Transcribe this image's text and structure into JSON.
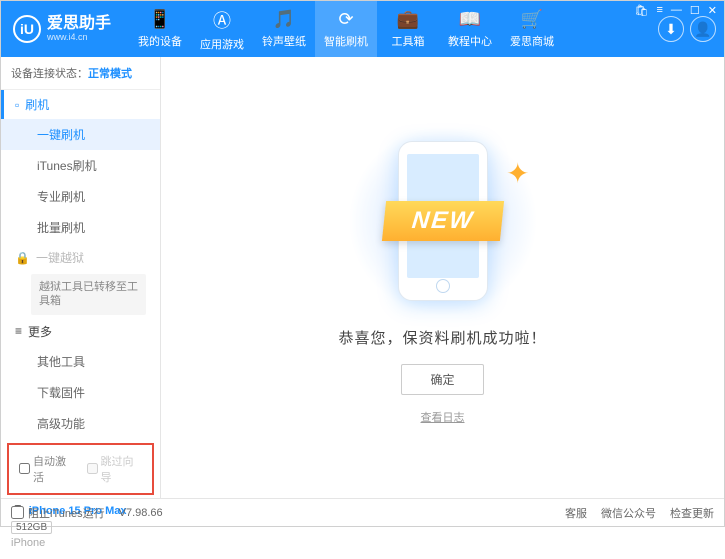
{
  "header": {
    "logo_letter": "iU",
    "app_name": "爱思助手",
    "website": "www.i4.cn",
    "nav": [
      {
        "icon": "📱",
        "label": "我的设备"
      },
      {
        "icon": "Ⓐ",
        "label": "应用游戏"
      },
      {
        "icon": "🎵",
        "label": "铃声壁纸"
      },
      {
        "icon": "⟳",
        "label": "智能刷机"
      },
      {
        "icon": "💼",
        "label": "工具箱"
      },
      {
        "icon": "📖",
        "label": "教程中心"
      },
      {
        "icon": "🛒",
        "label": "爱思商城"
      }
    ]
  },
  "sidebar": {
    "status_label": "设备连接状态：",
    "status_mode": "正常模式",
    "flash_header": "刷机",
    "flash_items": [
      "一键刷机",
      "iTunes刷机",
      "专业刷机",
      "批量刷机"
    ],
    "jailbreak_header": "一键越狱",
    "jailbreak_note": "越狱工具已转移至工具箱",
    "more_header": "更多",
    "more_items": [
      "其他工具",
      "下载固件",
      "高级功能"
    ],
    "cb_auto_activate": "自动激活",
    "cb_skip_setup": "跳过向导",
    "device_name": "iPhone 15 Pro Max",
    "storage": "512GB",
    "device_type": "iPhone"
  },
  "main": {
    "banner": "NEW",
    "success": "恭喜您，保资料刷机成功啦！",
    "ok": "确定",
    "view_log": "查看日志"
  },
  "footer": {
    "block_itunes": "阻止iTunes运行",
    "version": "V7.98.66",
    "links": [
      "客服",
      "微信公众号",
      "检查更新"
    ]
  }
}
